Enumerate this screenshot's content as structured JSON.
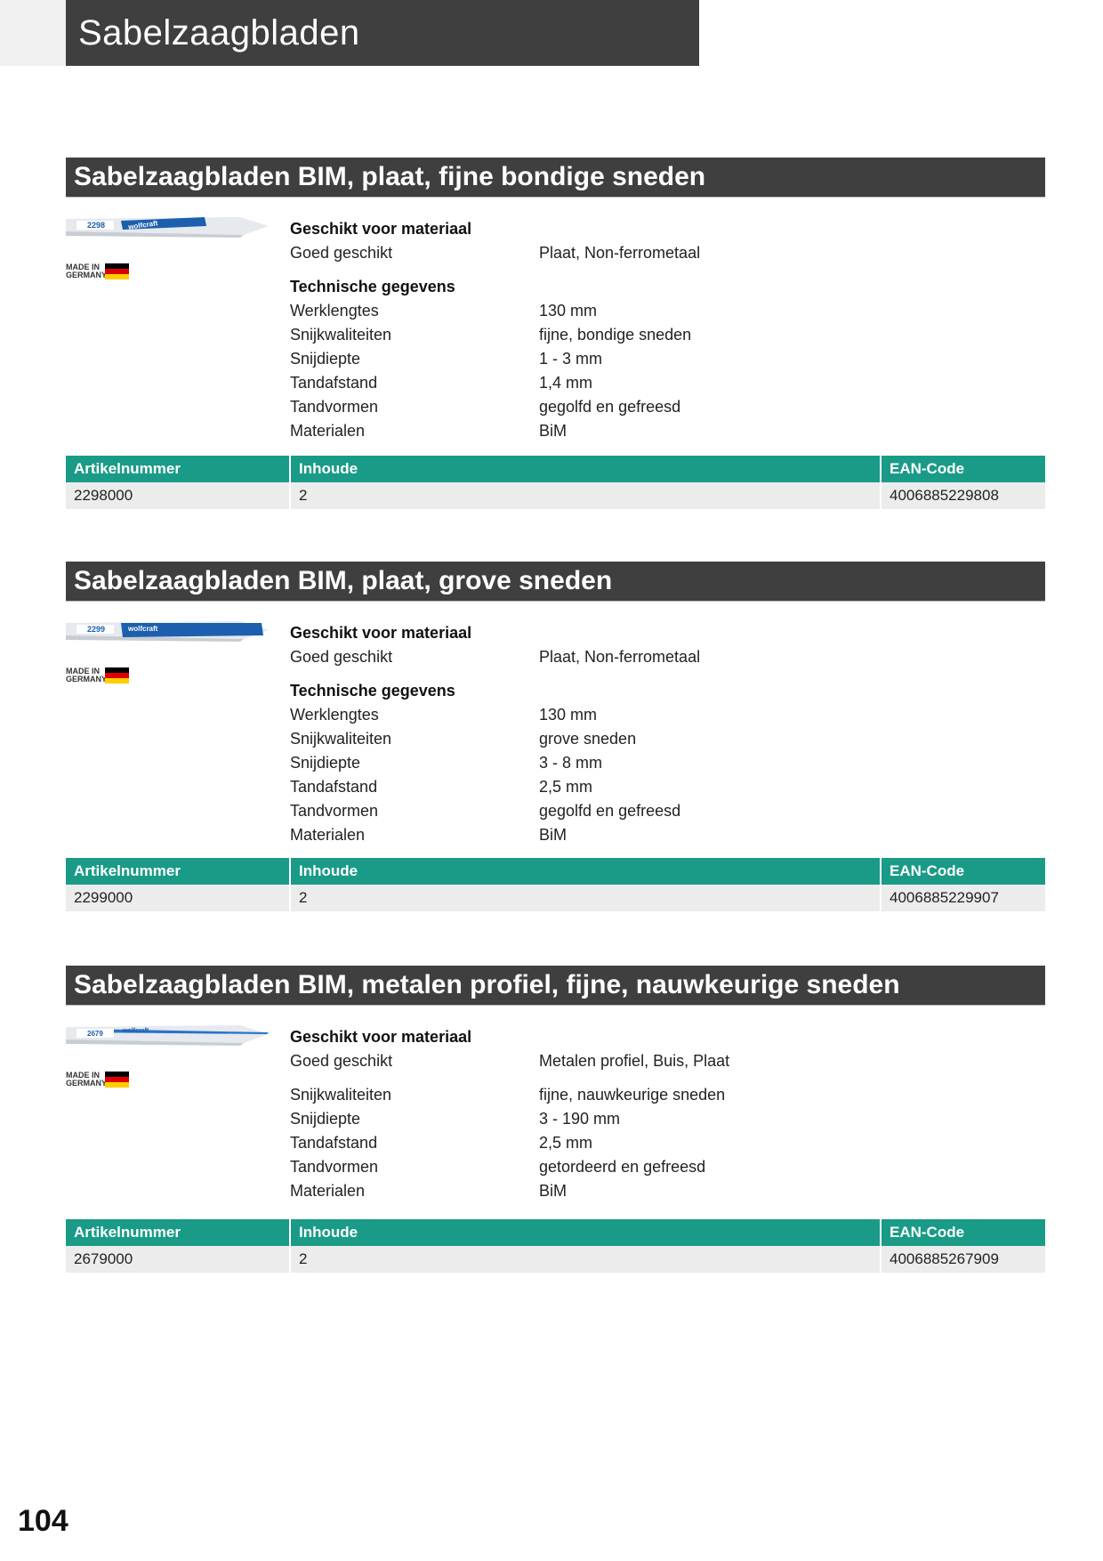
{
  "page": {
    "title": "Sabelzaagbladen",
    "number": "104"
  },
  "made_in": "MADE IN GERMANY",
  "table_headers": {
    "article": "Artikelnummer",
    "content": "Inhoude",
    "ean": "EAN-Code"
  },
  "sections": [
    {
      "title": "Sabelzaagbladen BIM, plaat, fijne bondige sneden",
      "blade_code": "2298",
      "material_header": "Geschikt voor materiaal",
      "material_label": "Goed geschikt",
      "material_value": "Plaat, Non-ferrometaal",
      "tech_header": "Technische gegevens",
      "specs": [
        {
          "k": "Werklengtes",
          "v": "130 mm"
        },
        {
          "k": "Snijkwaliteiten",
          "v": "fijne, bondige sneden"
        },
        {
          "k": "Snijdiepte",
          "v": "1 - 3 mm"
        },
        {
          "k": "Tandafstand",
          "v": "1,4 mm"
        },
        {
          "k": "Tandvormen",
          "v": "gegolfd en gefreesd"
        },
        {
          "k": "Materialen",
          "v": "BiM"
        }
      ],
      "article": "2298000",
      "content": "2",
      "ean": "4006885229808"
    },
    {
      "title": "Sabelzaagbladen BIM, plaat, grove sneden",
      "blade_code": "2299",
      "material_header": "Geschikt voor materiaal",
      "material_label": "Goed geschikt",
      "material_value": "Plaat, Non-ferrometaal",
      "tech_header": "Technische gegevens",
      "specs": [
        {
          "k": "Werklengtes",
          "v": "130 mm"
        },
        {
          "k": "Snijkwaliteiten",
          "v": "grove sneden"
        },
        {
          "k": "Snijdiepte",
          "v": "3 - 8 mm"
        },
        {
          "k": "Tandafstand",
          "v": "2,5 mm"
        },
        {
          "k": "Tandvormen",
          "v": "gegolfd en gefreesd"
        },
        {
          "k": "Materialen",
          "v": "BiM"
        }
      ],
      "article": "2299000",
      "content": "2",
      "ean": "4006885229907"
    },
    {
      "title": "Sabelzaagbladen BIM, metalen profiel, fijne, nauwkeurige sneden",
      "blade_code": "2679",
      "material_header": "Geschikt voor materiaal",
      "material_label": "Goed geschikt",
      "material_value": "Metalen profiel, Buis, Plaat",
      "specs": [
        {
          "k": "Snijkwaliteiten",
          "v": "fijne, nauwkeurige sneden"
        },
        {
          "k": "Snijdiepte",
          "v": "3 - 190 mm"
        },
        {
          "k": "Tandafstand",
          "v": "2,5 mm"
        },
        {
          "k": "Tandvormen",
          "v": "getordeerd en gefreesd"
        },
        {
          "k": "Materialen",
          "v": "BiM"
        }
      ],
      "article": "2679000",
      "content": "2",
      "ean": "4006885267909"
    }
  ]
}
